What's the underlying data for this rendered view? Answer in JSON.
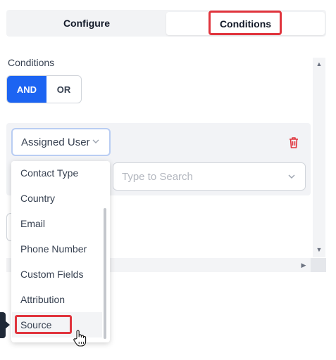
{
  "tabs": {
    "configure": "Configure",
    "conditions": "Conditions"
  },
  "conditions": {
    "label": "Conditions",
    "logic": {
      "and": "AND",
      "or": "OR",
      "selected": "AND"
    }
  },
  "condition_row": {
    "field_value": "Assigned User",
    "search_placeholder": "Type to Search"
  },
  "dropdown": {
    "options": [
      "Contact Type",
      "Country",
      "Email",
      "Phone Number",
      "Custom Fields",
      "Attribution",
      "Source"
    ],
    "highlighted": "Source"
  },
  "colors": {
    "accent": "#1c64f2",
    "highlight": "#e0343d",
    "delete": "#e0343d"
  },
  "icons": [
    "chevron-down-icon",
    "trash-icon",
    "hand-pointer-icon"
  ]
}
